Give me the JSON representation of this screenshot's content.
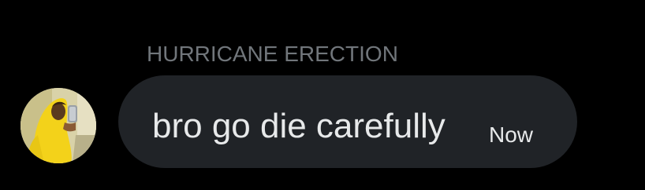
{
  "message": {
    "sender_name": "HURRICANE ERECTION",
    "avatar_icon": "banana-costume-avatar",
    "text": "bro go die carefully",
    "timestamp": "Now"
  },
  "colors": {
    "background": "#000000",
    "bubble": "#202327",
    "name_text": "#71767b",
    "message_text": "#e7e9ea"
  }
}
